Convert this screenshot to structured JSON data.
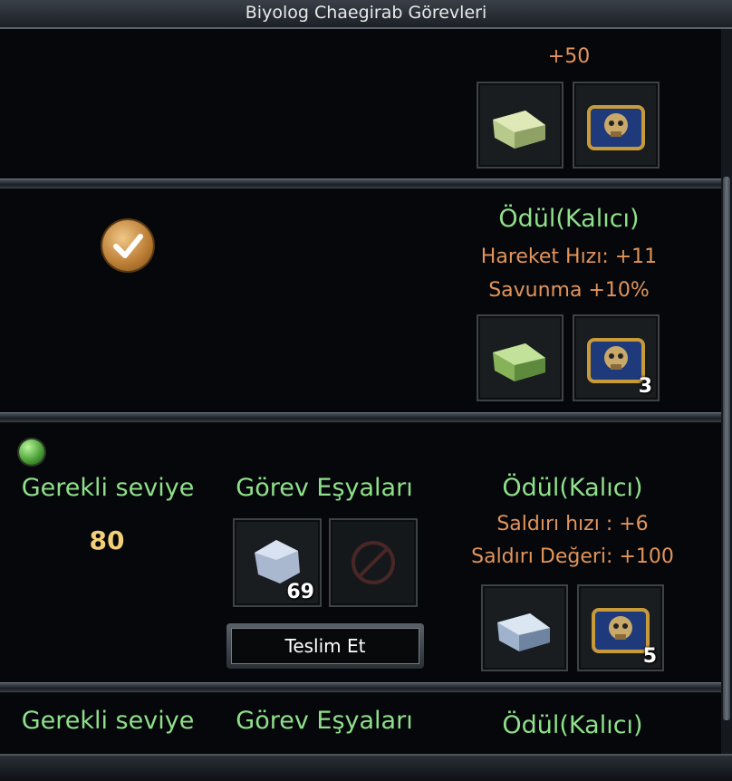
{
  "window": {
    "title": "Biyolog Chaegirab Görevleri"
  },
  "quest1": {
    "points": "+50"
  },
  "quest2": {
    "reward_title": "Ödül(Kalıcı)",
    "reward_line1": "Hareket Hızı: +11",
    "reward_line2": "Savunma +10%",
    "chest_count": "3",
    "status_icon": "checkmark-icon"
  },
  "quest3": {
    "level_label": "Gerekli seviye",
    "level_value": "80",
    "items_label": "Görev Eşyaları",
    "item_count": "69",
    "submit_label": "Teslim Et",
    "reward_title": "Ödül(Kalıcı)",
    "reward_line1": "Saldırı hızı : +6",
    "reward_line2": "Saldırı Değeri: +100",
    "chest_count": "5"
  },
  "quest4": {
    "level_label": "Gerekli seviye",
    "items_label": "Görev Eşyaları",
    "reward_title": "Ödül(Kalıcı)"
  },
  "colors": {
    "green": "#8fe08a",
    "orange": "#e2945a",
    "gold": "#f2cf78"
  }
}
